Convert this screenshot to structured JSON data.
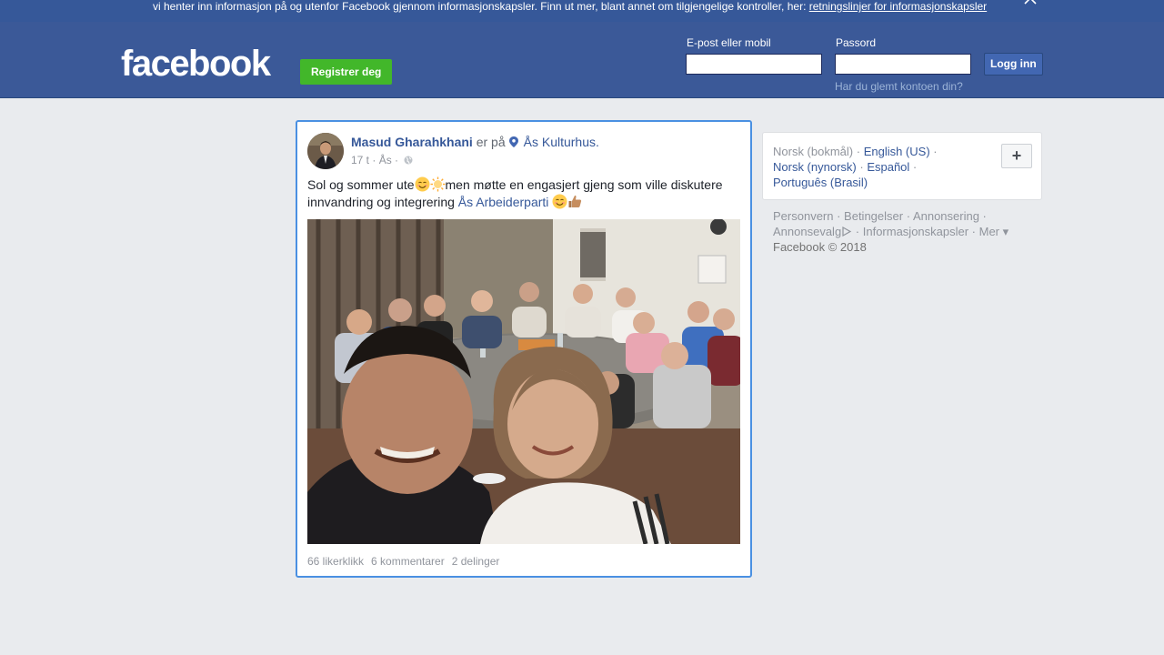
{
  "cookie_banner": {
    "text": "vi henter inn informasjon på og utenfor Facebook gjennom informasjonskapsler. Finn ut mer, blant annet om tilgjengelige kontroller, her: ",
    "link": "retningslinjer for informasjonskapsler",
    "close_icon": "close-icon"
  },
  "header": {
    "logo": "facebook",
    "register_label": "Registrer deg",
    "email_label": "E-post eller mobil",
    "email_value": "",
    "password_label": "Passord",
    "password_value": "",
    "login_label": "Logg inn",
    "forgot_label": "Har du glemt kontoen din?"
  },
  "post": {
    "author": "Masud Gharahkhani",
    "is_at": "er på",
    "place": "Ås Kulturhus.",
    "time": "17 t",
    "location": "Ås",
    "privacy_icon": "globe-icon",
    "text_part1": "Sol og sommer ute",
    "text_part2": "men møtte en engasjert gjeng som ville diskutere innvandring og integrering ",
    "mention": "Ås Arbeiderparti",
    "likes": "66 likerklikk",
    "comments": "6 kommentarer",
    "shares": "2 delinger"
  },
  "languages": {
    "current": "Norsk (bokmål)",
    "english": "English (US)",
    "nynorsk": "Norsk (nynorsk)",
    "spanish": "Español",
    "portuguese": "Português (Brasil)",
    "add_icon": "plus-icon"
  },
  "footer": {
    "privacy": "Personvern",
    "terms": "Betingelser",
    "advertising": "Annonsering",
    "ad_choices": "Annonsevalg",
    "cookies": "Informasjonskapsler",
    "more": "Mer",
    "copyright": "Facebook © 2018"
  },
  "colors": {
    "brand": "#3b5998",
    "link": "#365899",
    "register": "#42b72a",
    "focus_border": "#4a90e2"
  }
}
